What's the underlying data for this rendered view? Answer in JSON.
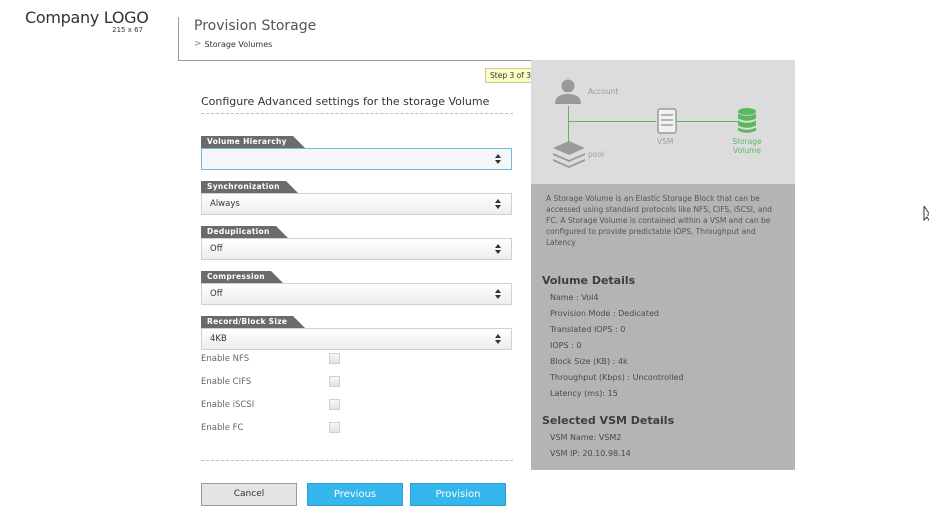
{
  "logo": {
    "text": "Company LOGO",
    "size": "215 x 67"
  },
  "header": {
    "title": "Provision Storage",
    "breadcrumb": "Storage Volumes"
  },
  "step_badge": "Step 3 of 3",
  "form": {
    "title": "Configure Advanced settings for the storage Volume",
    "fields": [
      {
        "label": "Volume Hierarchy",
        "value": ""
      },
      {
        "label": "Synchronization",
        "value": "Always"
      },
      {
        "label": "Deduplication",
        "value": "Off"
      },
      {
        "label": "Compression",
        "value": "Off"
      },
      {
        "label": "Record/Block Size",
        "value": "4KB"
      }
    ],
    "checkboxes": [
      {
        "label": "Enable NFS",
        "checked": false
      },
      {
        "label": "Enable CIFS",
        "checked": false
      },
      {
        "label": "Enable iSCSI",
        "checked": false
      },
      {
        "label": "Enable FC",
        "checked": false
      }
    ]
  },
  "buttons": {
    "cancel": "Cancel",
    "previous": "Previous",
    "provision": "Provision"
  },
  "diagram": {
    "account": "Account",
    "vsm": "VSM",
    "pool": "pool",
    "storage_line1": "Storage",
    "storage_line2": "Volume",
    "active_color": "#5cb85c",
    "inactive_color": "#9c9c9c"
  },
  "description": "A Storage Volume is an Elastic Storage Block that can be accessed using standard protocols like NFS, CIFS, iSCSI, and FC. A Storage Volume is contained within a VSM and can be configured to provide predictable IOPS, Throughput and Latency",
  "volume_details": {
    "title": "Volume Details",
    "items": [
      "Name : Vol4",
      "Provision Mode : Dedicated",
      "Translated IOPS : 0",
      "IOPS : 0",
      "Block Size (KB) : 4k",
      "Throughput (Kbps) : Uncontrolled",
      "Latency (ms): 15"
    ]
  },
  "vsm_details": {
    "title": "Selected VSM Details",
    "items": [
      "VSM Name: VSM2",
      "VSM IP: 20.10.98.14"
    ]
  },
  "colors": {
    "accent": "#35b7ec",
    "panel": "#b4b4b4",
    "diagram_bg": "#dcdcdc"
  }
}
